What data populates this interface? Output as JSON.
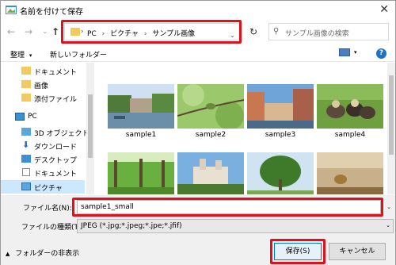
{
  "window": {
    "title": "名前を付けて保存"
  },
  "nav": {
    "back": "←",
    "forward": "→",
    "up": "↑",
    "refresh": "↻"
  },
  "address": {
    "crumbs": [
      "PC",
      "ピクチャ",
      "サンプル画像"
    ]
  },
  "search": {
    "placeholder": "サンプル画像の検索"
  },
  "toolbar": {
    "organize": "整理",
    "new_folder": "新しいフォルダー",
    "help": "?"
  },
  "sidebar": {
    "items": [
      {
        "label": "ドキュメント",
        "icon": "document-folder-icon"
      },
      {
        "label": "画像",
        "icon": "folder-icon"
      },
      {
        "label": "添付ファイル",
        "icon": "folder-icon"
      },
      {
        "label": "PC",
        "icon": "pc-icon"
      },
      {
        "label": "3D オブジェクト",
        "icon": "3d-objects-icon"
      },
      {
        "label": "ダウンロード",
        "icon": "download-icon"
      },
      {
        "label": "デスクトップ",
        "icon": "desktop-icon"
      },
      {
        "label": "ドキュメント",
        "icon": "document-icon"
      },
      {
        "label": "ピクチャ",
        "icon": "pictures-icon"
      }
    ]
  },
  "files": [
    {
      "name": "sample1"
    },
    {
      "name": "sample2"
    },
    {
      "name": "sample3"
    },
    {
      "name": "sample4"
    },
    {
      "name": ""
    },
    {
      "name": ""
    },
    {
      "name": ""
    },
    {
      "name": ""
    }
  ],
  "filename": {
    "label": "ファイル名(N):",
    "value": "sample1_small"
  },
  "filetype": {
    "label": "ファイルの種類(T):",
    "value": "JPEG (*.jpg;*.jpeg;*.jpe;*.jfif)"
  },
  "footer": {
    "hide_folders": "フォルダーの非表示",
    "save": "保存(S)",
    "cancel": "キャンセル"
  },
  "colors": {
    "highlight": "#e0101c",
    "selected": "#cce8ff",
    "accent": "#0078d7"
  }
}
